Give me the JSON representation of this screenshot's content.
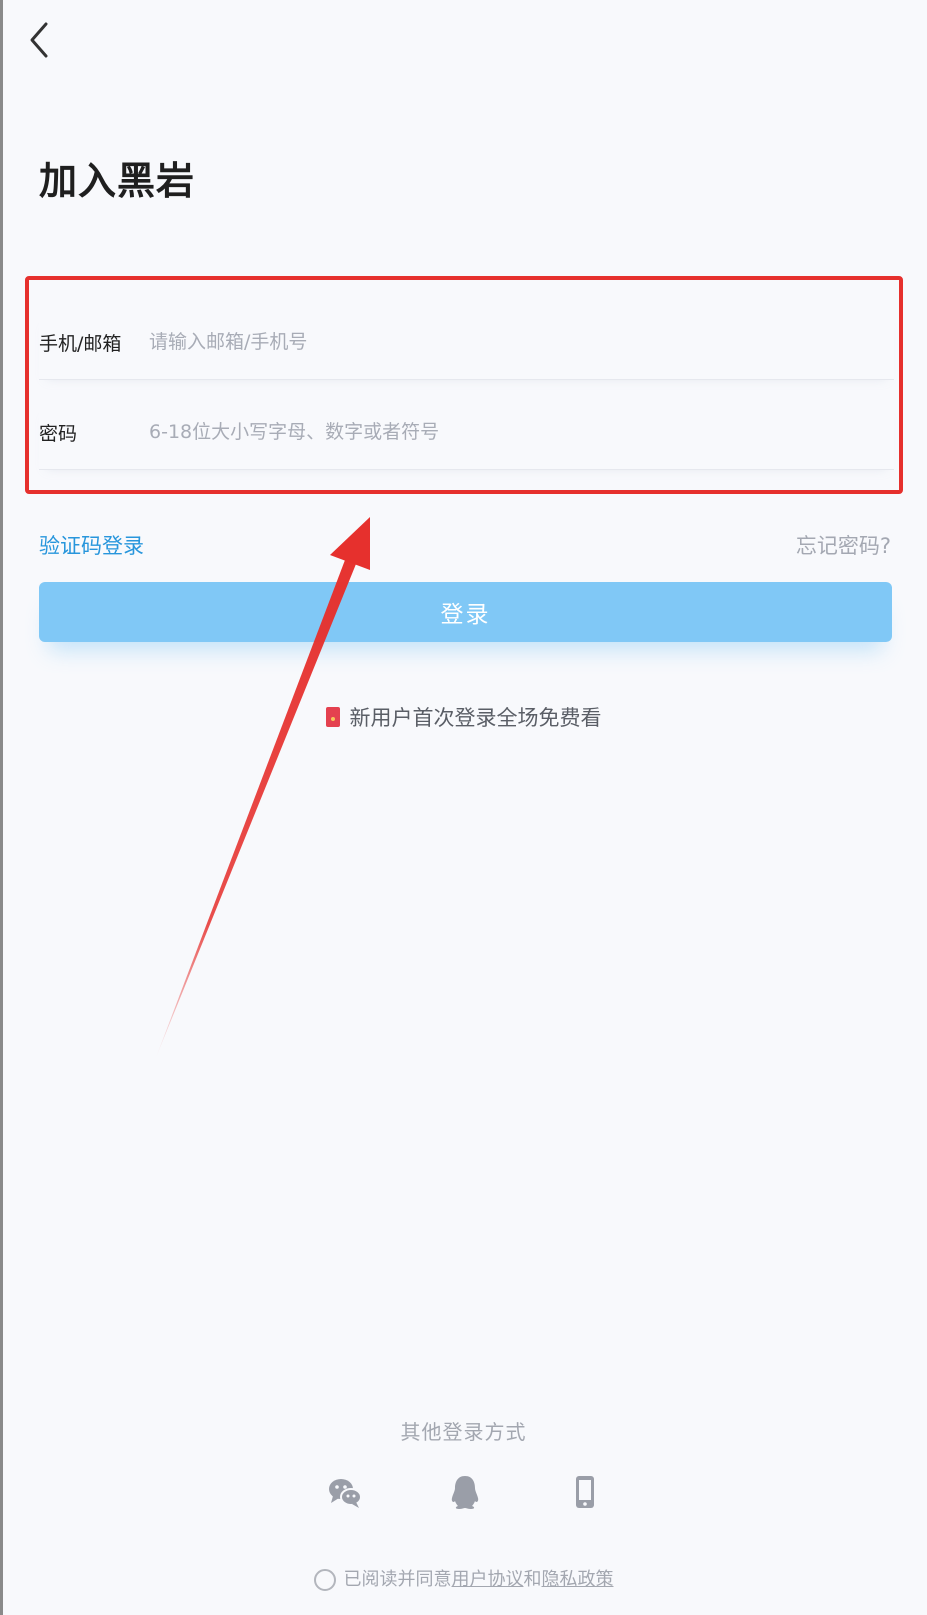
{
  "header": {
    "title": "加入黑岩"
  },
  "form": {
    "phone_label": "手机/邮箱",
    "phone_placeholder": "请输入邮箱/手机号",
    "phone_value": "",
    "password_label": "密码",
    "password_placeholder": "6-18位大小写字母、数字或者符号",
    "password_value": ""
  },
  "links": {
    "sms_login": "验证码登录",
    "forgot_password": "忘记密码?"
  },
  "login_button": "登录",
  "promo": "新用户首次登录全场免费看",
  "other_login": {
    "title": "其他登录方式",
    "methods": [
      "wechat-icon",
      "qq-icon",
      "phone-icon"
    ]
  },
  "agreement": {
    "prefix": "已阅读并同意",
    "user_agreement": "用户协议",
    "and": "和",
    "privacy_policy": "隐私政策"
  },
  "colors": {
    "accent": "#2896dc",
    "button": "#80c8f6",
    "highlight": "#e6302d",
    "background": "#f8f9fc"
  }
}
